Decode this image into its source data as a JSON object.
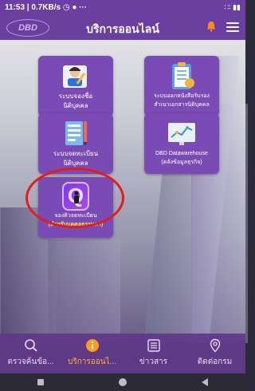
{
  "status_bar": {
    "time_info": "11:53 | 0.7KB/s ◷ ● ···",
    "right_icons": "∷∶ ▮▮"
  },
  "header": {
    "logo": "DBD",
    "title": "บริการออนไลน์"
  },
  "tiles": [
    {
      "label": "ระบบจองชื่อ",
      "sub": "นิติบุคคล"
    },
    {
      "label": "ระบบออกหนังสือรับรอง",
      "sub": "สำเนาเอกสารนิติบุคคล"
    },
    {
      "label": "ระบบจดทะเบียน",
      "sub": "นิติบุคคล"
    },
    {
      "label": "DBD Datawarehouse",
      "sub": "(คลังข้อมูลธุรกิจ)"
    },
    {
      "label": "จองคิวจดทะเบียน",
      "sub": "(สำหรับบุคคลธรรมดา)"
    }
  ],
  "bottom_nav": [
    {
      "label": "ตรวจค้นข้อ...",
      "icon": "search-icon",
      "active": false
    },
    {
      "label": "บริการออนไ...",
      "icon": "info-icon",
      "active": true
    },
    {
      "label": "ข่าวสาร",
      "icon": "news-icon",
      "active": false
    },
    {
      "label": "ติดต่อกรม",
      "icon": "location-icon",
      "active": false
    }
  ],
  "colors": {
    "header": "#6b3fa0",
    "tile": "#7b4bb5",
    "active_nav": "#ffb23e",
    "highlight_ring": "#e01c1c"
  }
}
